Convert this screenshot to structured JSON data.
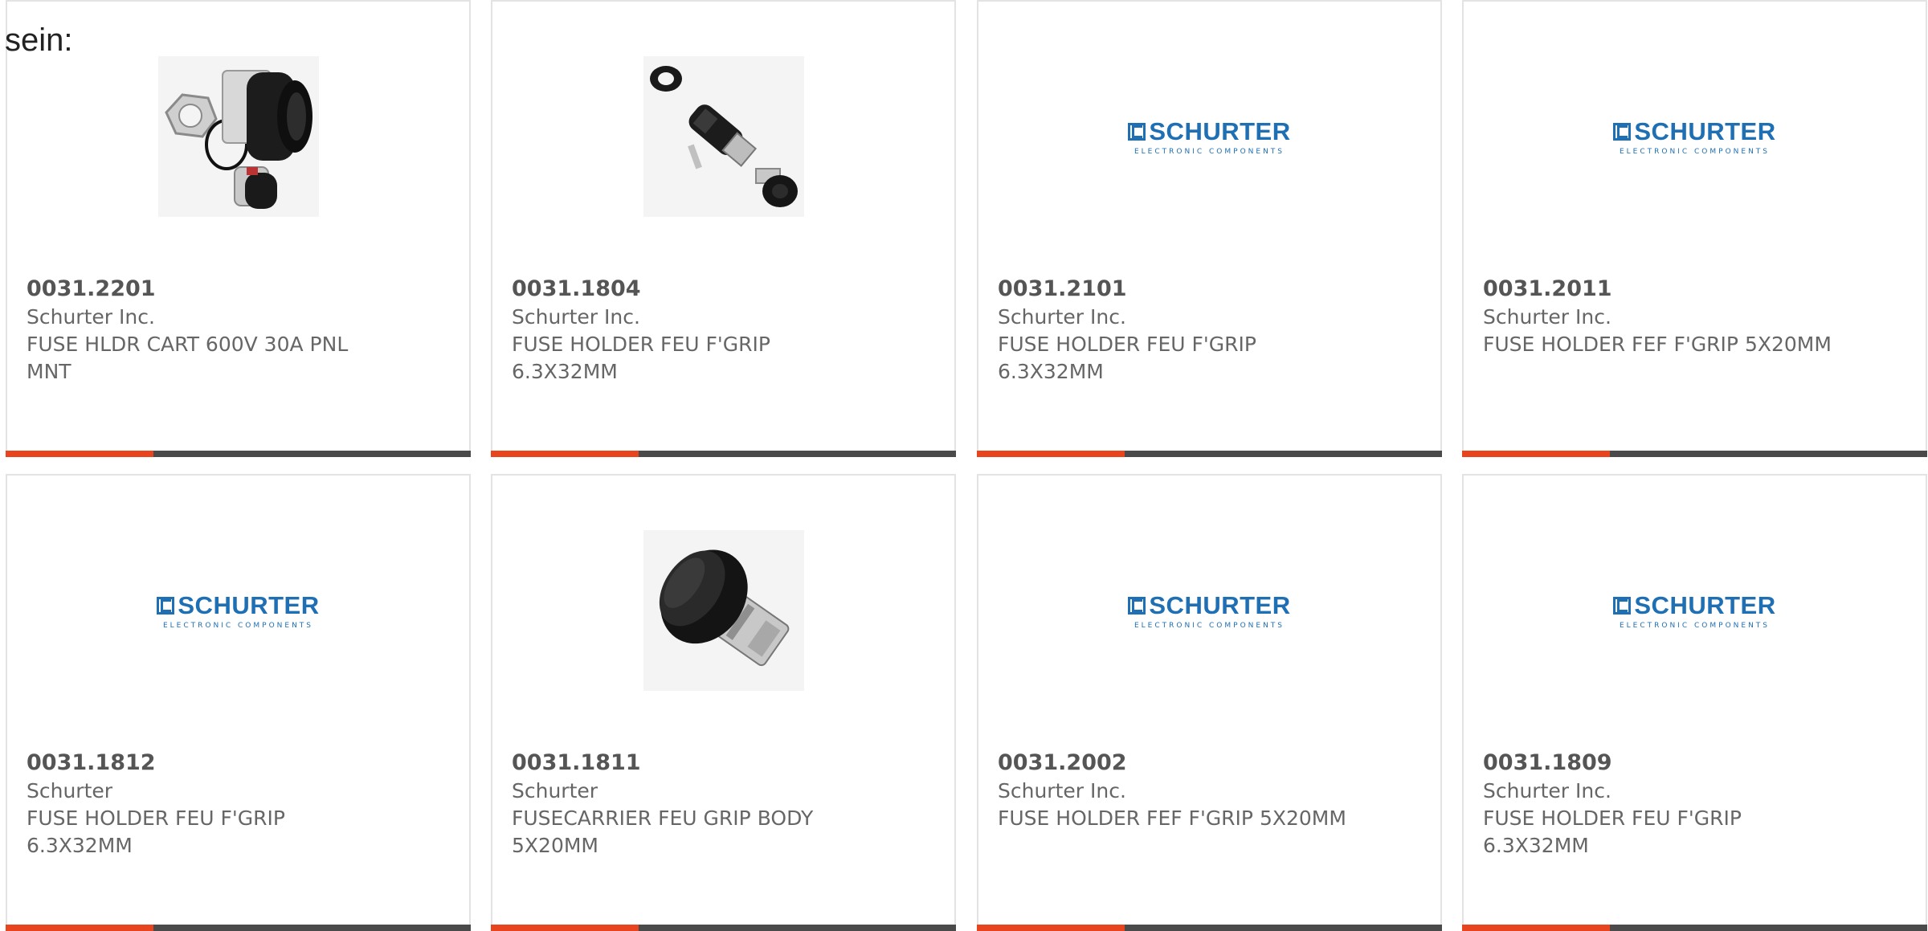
{
  "intro_text": "sein:",
  "brand": {
    "accent": "#e8451e",
    "bar": "#4a4a4a",
    "logo_blue": "#1e6fb3"
  },
  "logo": {
    "word": "SCHURTER",
    "tagline": "ELECTRONIC COMPONENTS"
  },
  "products": [
    {
      "part_number": "0031.2201",
      "manufacturer": "Schurter Inc.",
      "description": "FUSE HLDR CART 600V 30A PNL MNT",
      "image": "fuse-holder-photo"
    },
    {
      "part_number": "0031.1804",
      "manufacturer": "Schurter Inc.",
      "description": "FUSE HOLDER FEU F'GRIP 6.3X32MM",
      "image": "fuse-holder-exploded-photo"
    },
    {
      "part_number": "0031.2101",
      "manufacturer": "Schurter Inc.",
      "description": "FUSE HOLDER FEU F'GRIP 6.3X32MM",
      "image": "schurter-logo"
    },
    {
      "part_number": "0031.2011",
      "manufacturer": "Schurter Inc.",
      "description": "FUSE HOLDER FEF F'GRIP 5X20MM",
      "image": "schurter-logo"
    },
    {
      "part_number": "0031.1812",
      "manufacturer": "Schurter",
      "description": "FUSE HOLDER FEU F'GRIP 6.3X32MM",
      "image": "schurter-logo"
    },
    {
      "part_number": "0031.1811",
      "manufacturer": "Schurter",
      "description": "FUSECARRIER FEU GRIP BODY 5X20MM",
      "image": "fuse-carrier-photo"
    },
    {
      "part_number": "0031.2002",
      "manufacturer": "Schurter Inc.",
      "description": "FUSE HOLDER FEF F'GRIP 5X20MM",
      "image": "schurter-logo"
    },
    {
      "part_number": "0031.1809",
      "manufacturer": "Schurter Inc.",
      "description": "FUSE HOLDER FEU F'GRIP 6.3X32MM",
      "image": "schurter-logo"
    }
  ]
}
